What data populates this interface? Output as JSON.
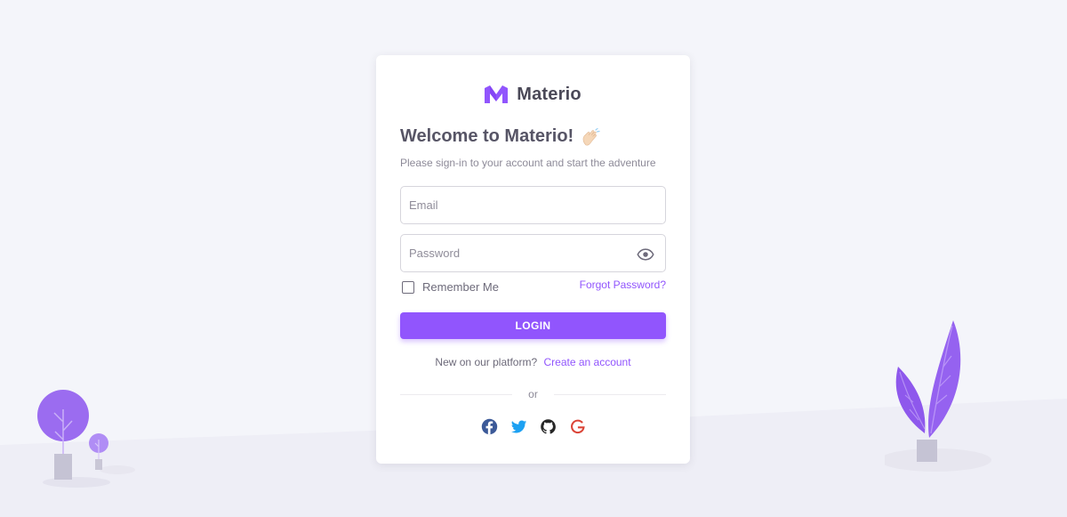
{
  "brand": {
    "name": "Materio"
  },
  "welcome": {
    "title": "Welcome to Materio!",
    "subtitle": "Please sign-in to your account and start the adventure"
  },
  "form": {
    "email_placeholder": "Email",
    "password_placeholder": "Password",
    "remember_label": "Remember Me",
    "forgot_label": "Forgot Password?",
    "login_label": "LOGIN"
  },
  "signup": {
    "text": "New on our platform?",
    "link": "Create an account"
  },
  "divider": {
    "text": "or"
  },
  "social": [
    "facebook-icon",
    "twitter-icon",
    "github-icon",
    "google-icon"
  ],
  "colors": {
    "primary": "#9155fd",
    "background": "#f4f5fa",
    "facebook": "#3b5998",
    "twitter": "#1da1f2",
    "github": "#272727",
    "google": "#db4437"
  }
}
